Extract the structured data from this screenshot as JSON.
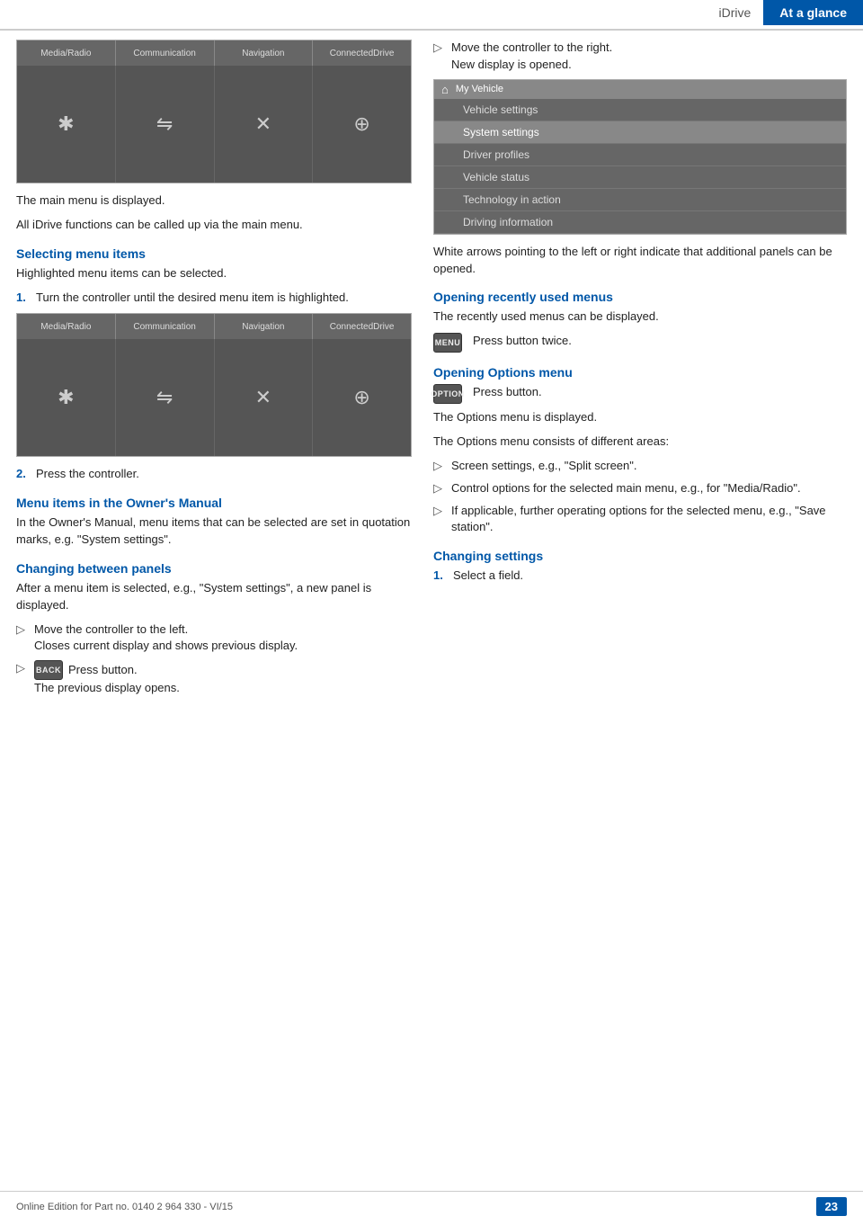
{
  "header": {
    "idrive_label": "iDrive",
    "ataglance_label": "At a glance"
  },
  "left_col": {
    "screen1": {
      "menu_items": [
        "Media/Radio",
        "Communication",
        "Navigation",
        "ConnectedDrive"
      ],
      "icons": [
        "✱",
        "⇋",
        "✕",
        "⊕"
      ]
    },
    "caption1": "The main menu is displayed.",
    "caption2": "All iDrive functions can be called up via the main menu.",
    "section1": {
      "heading": "Selecting menu items",
      "intro": "Highlighted menu items can be selected.",
      "steps": [
        {
          "num": "1.",
          "text": "Turn the controller until the desired menu item is highlighted."
        }
      ]
    },
    "screen2": {
      "menu_items": [
        "Media/Radio",
        "Communication",
        "Navigation",
        "ConnectedDrive"
      ],
      "icons": [
        "✱",
        "⇋",
        "✕",
        "⊕"
      ]
    },
    "steps2": [
      {
        "num": "2.",
        "text": "Press the controller."
      }
    ],
    "section2": {
      "heading": "Menu items in the Owner's Manual",
      "text": "In the Owner's Manual, menu items that can be selected are set in quotation marks, e.g. \"System settings\"."
    },
    "section3": {
      "heading": "Changing between panels",
      "text": "After a menu item is selected, e.g., \"System settings\", a new panel is displayed.",
      "bullets": [
        {
          "arrow": "▷",
          "text": "Move the controller to the left.",
          "subtext": "Closes current display and shows previous display."
        }
      ],
      "back_btn": {
        "label": "BACK",
        "text": "Press button.",
        "subtext": "The previous display opens."
      }
    }
  },
  "right_col": {
    "bullet1": {
      "arrow": "▷",
      "text": "Move the controller to the right.",
      "subtext": "New display is opened."
    },
    "screen": {
      "topbar_label": "My Vehicle",
      "items": [
        {
          "label": "Vehicle settings",
          "state": "normal"
        },
        {
          "label": "System settings",
          "state": "highlighted"
        },
        {
          "label": "Driver profiles",
          "state": "normal"
        },
        {
          "label": "Vehicle status",
          "state": "normal"
        },
        {
          "label": "Technology in action",
          "state": "normal"
        },
        {
          "label": "Driving information",
          "state": "normal"
        }
      ]
    },
    "caption": "White arrows pointing to the left or right indicate that additional panels can be opened.",
    "section_recently": {
      "heading": "Opening recently used menus",
      "text": "The recently used menus can be displayed.",
      "btn_label": "MENU",
      "btn_text": "Press button twice."
    },
    "section_options": {
      "heading": "Opening Options menu",
      "btn_label": "OPTION",
      "btn_text": "Press button.",
      "caption1": "The Options menu is displayed.",
      "caption2": "The Options menu consists of different areas:",
      "bullets": [
        {
          "arrow": "▷",
          "text": "Screen settings, e.g., \"Split screen\"."
        },
        {
          "arrow": "▷",
          "text": "Control options for the selected main menu, e.g., for \"Media/Radio\"."
        },
        {
          "arrow": "▷",
          "text": "If applicable, further operating options for the selected menu, e.g., \"Save station\"."
        }
      ]
    },
    "section_changing": {
      "heading": "Changing settings",
      "steps": [
        {
          "num": "1.",
          "text": "Select a field."
        }
      ]
    }
  },
  "footer": {
    "text": "Online Edition for Part no. 0140 2 964 330 - VI/15",
    "page": "23"
  }
}
